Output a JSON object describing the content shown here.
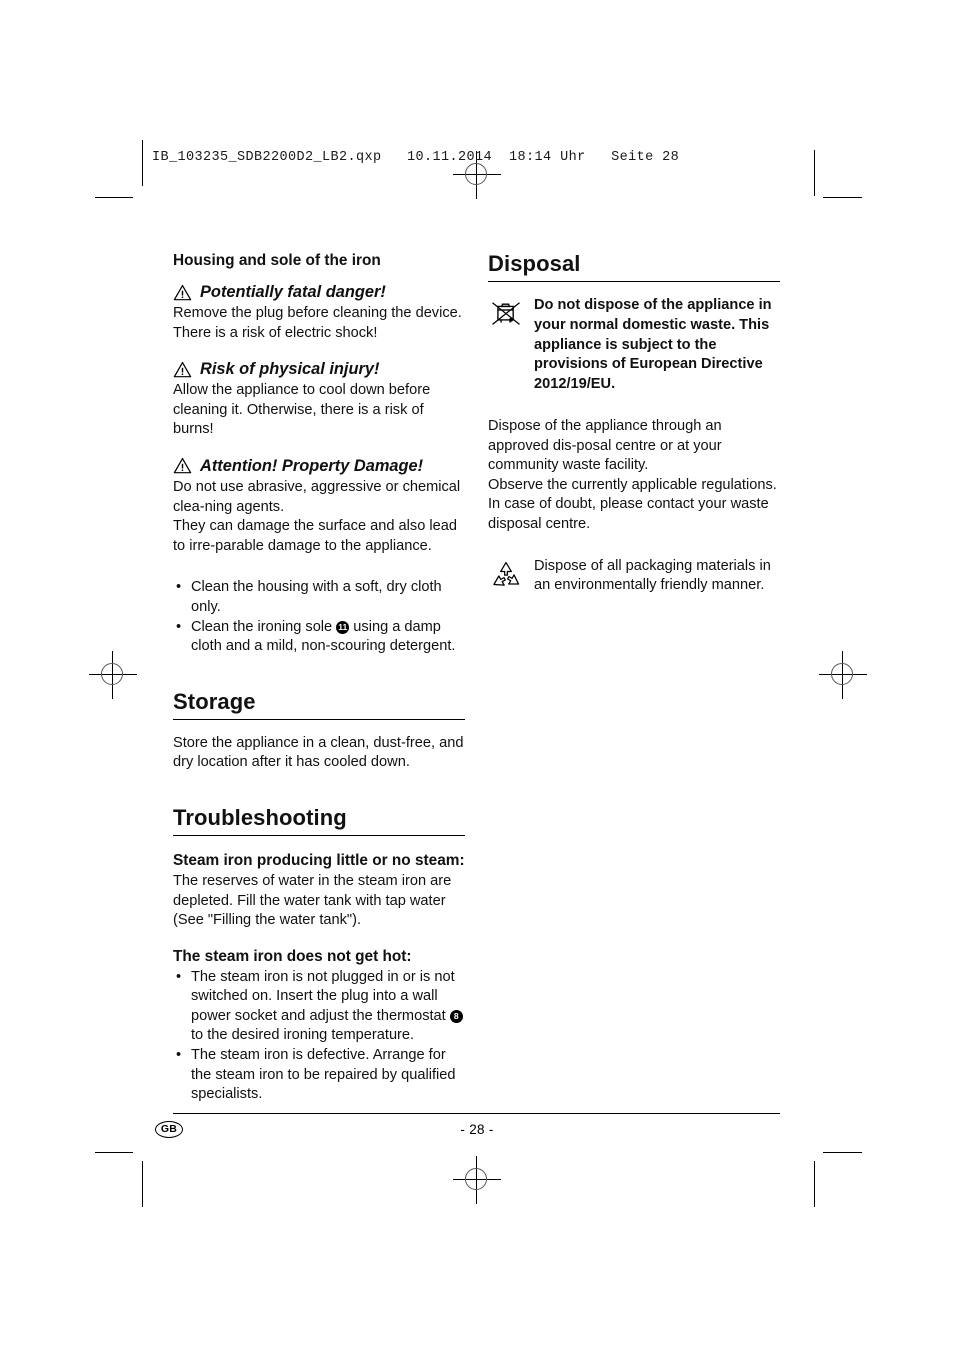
{
  "print_header": "IB_103235_SDB2200D2_LB2.qxp   10.11.2014  18:14 Uhr   Seite 28",
  "left_column": {
    "subhead": "Housing and sole of the iron",
    "warnings": [
      {
        "icon": "warning-triangle-icon",
        "title": "Potentially fatal danger!",
        "body": "Remove the plug before cleaning the device. There is a risk of electric shock!"
      },
      {
        "icon": "warning-triangle-icon",
        "title": "Risk of physical injury!",
        "body": "Allow the appliance to cool down before cleaning it. Otherwise, there is a risk of burns!"
      },
      {
        "icon": "warning-triangle-icon",
        "title": "Attention! Property Damage!",
        "body_line1": "Do not use abrasive, aggressive or chemical clea-ning agents.",
        "body_line2": "They can damage the surface and also lead to irre-parable damage to the appliance."
      }
    ],
    "cleaning_bullets": [
      {
        "text": "Clean the housing with a soft, dry cloth only."
      },
      {
        "text_before": "Clean the ironing sole",
        "ref": "11",
        "text_after": "using a damp cloth and a mild, non-scouring detergent."
      }
    ],
    "storage": {
      "heading": "Storage",
      "body": "Store the appliance in a clean, dust-free, and dry location after it has cooled down."
    },
    "troubleshooting": {
      "heading": "Troubleshooting",
      "problems": [
        {
          "title": "Steam iron producing little or no steam:",
          "body": "The reserves of water in the steam iron are depleted. Fill the water tank with tap water (See \"Filling the water tank\")."
        },
        {
          "title": "The steam iron does not get hot:",
          "bullets": [
            {
              "text_before": "The steam iron is not plugged in or is not switched on. Insert the plug into a wall power socket and adjust the thermostat",
              "ref": "8",
              "text_after": "to the desired ironing temperature."
            },
            {
              "text": "The steam iron is defective. Arrange for the steam iron to be repaired by qualified specialists."
            }
          ]
        }
      ]
    }
  },
  "right_column": {
    "heading": "Disposal",
    "weee_notice": {
      "icon": "crossed-out-wheelie-bin-icon",
      "text": "Do not dispose of the appliance in your normal domestic waste. This appliance is subject to the provisions of European Directive 2012/19/EU."
    },
    "disposal_body_lines": [
      "Dispose of the appliance through an approved dis-posal centre or at your community waste facility.",
      "Observe the currently applicable regulations.",
      "In case of doubt, please contact your waste disposal centre."
    ],
    "packaging_notice": {
      "icon": "recycling-loop-icon",
      "text": "Dispose of all packaging materials in an environmentally friendly manner."
    }
  },
  "footer": {
    "language_badge": "GB",
    "page_number": "- 28 -"
  }
}
